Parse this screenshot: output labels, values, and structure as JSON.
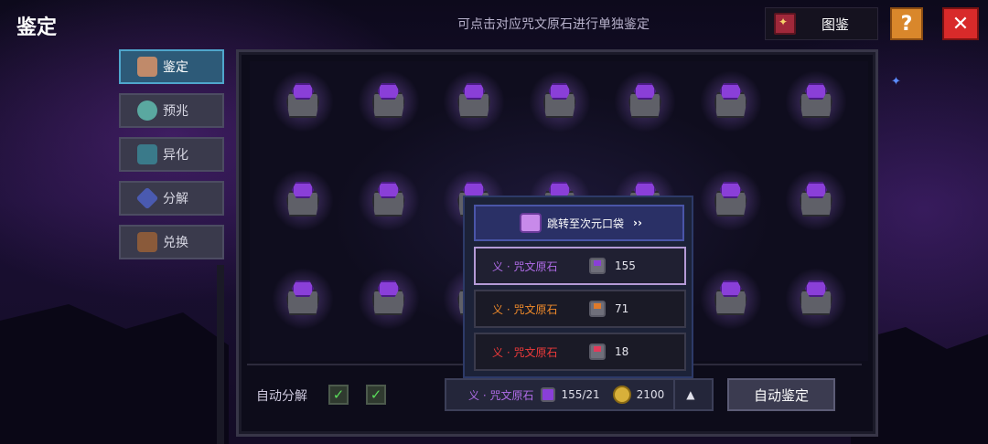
{
  "header": {
    "title": "鉴定",
    "hint": "可点击对应咒文原石进行单独鉴定",
    "atlas_label": "图鉴",
    "help_label": "?",
    "close_label": "✕"
  },
  "sidebar": {
    "items": [
      {
        "label": "鉴定",
        "active": true
      },
      {
        "label": "预兆",
        "active": false
      },
      {
        "label": "异化",
        "active": false
      },
      {
        "label": "分解",
        "active": false
      },
      {
        "label": "兑换",
        "active": false
      }
    ]
  },
  "stone_grid": {
    "rows": 3,
    "cols": 7,
    "item": "purple-rune-stone"
  },
  "bottom": {
    "auto_decompose_label": "自动分解",
    "checkbox_1_checked": true,
    "checkbox_2_checked": true,
    "checkmark": "✓",
    "selected_stone_name": "义 · 咒文原石",
    "stone_count": "155/21",
    "gold_amount": "2100",
    "expand_arrow": "▲",
    "auto_identify_label": "自动鉴定"
  },
  "popup": {
    "jump_label": "跳转至次元口袋",
    "jump_chevron": "››",
    "options": [
      {
        "name": "义 · 咒文原石",
        "count": "155",
        "name_color": "#b06ce8",
        "gem_color": "#8a3fd8",
        "selected": true
      },
      {
        "name": "义 · 咒文原石",
        "count": "71",
        "name_color": "#f08a2a",
        "gem_color": "#e07a2a",
        "selected": false
      },
      {
        "name": "义 · 咒文原石",
        "count": "18",
        "name_color": "#ee3a3a",
        "gem_color": "#e23a5a",
        "selected": false
      }
    ]
  },
  "colors": {
    "active_tab": "#2d5a78",
    "help_button": "#d9872b",
    "close_button": "#d82a2a"
  }
}
